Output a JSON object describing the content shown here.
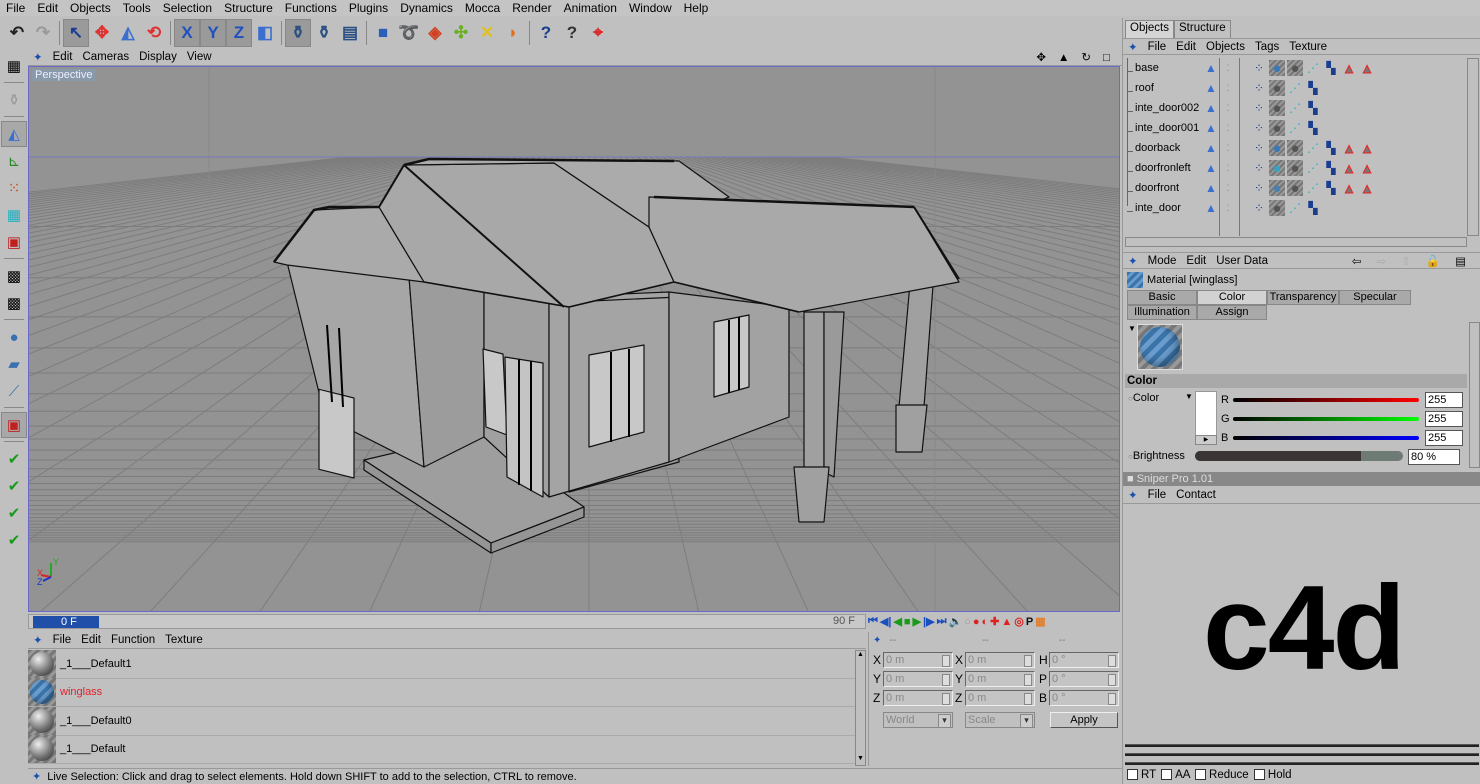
{
  "menubar": [
    "File",
    "Edit",
    "Objects",
    "Tools",
    "Selection",
    "Structure",
    "Functions",
    "Plugins",
    "Dynamics",
    "Mocca",
    "Render",
    "Animation",
    "Window",
    "Help"
  ],
  "toolbar": {
    "buttons": [
      {
        "name": "undo",
        "glyph": "↶"
      },
      {
        "name": "redo",
        "glyph": "↷"
      },
      {
        "name": "live-selection",
        "glyph": "↖",
        "selected": true
      },
      {
        "name": "move",
        "glyph": "✥"
      },
      {
        "name": "scale",
        "glyph": "◭"
      },
      {
        "name": "rotate",
        "glyph": "⟲"
      },
      {
        "name": "x-axis-lock",
        "glyph": "X"
      },
      {
        "name": "y-axis-lock",
        "glyph": "Y"
      },
      {
        "name": "z-axis-lock",
        "glyph": "Z"
      },
      {
        "name": "world-coords",
        "glyph": "⌐"
      },
      {
        "name": "render-view",
        "glyph": "⚱"
      },
      {
        "name": "render-picture-viewer",
        "glyph": "⚱"
      },
      {
        "name": "render-settings",
        "glyph": "▤"
      },
      {
        "name": "add-cube",
        "glyph": "■"
      },
      {
        "name": "add-spline",
        "glyph": "➰"
      },
      {
        "name": "add-nurbs",
        "glyph": "◈"
      },
      {
        "name": "add-array",
        "glyph": "✣"
      },
      {
        "name": "add-deformer",
        "glyph": "✕"
      },
      {
        "name": "add-scene",
        "glyph": "◗"
      },
      {
        "name": "help-pointer",
        "glyph": "?"
      },
      {
        "name": "help-window",
        "glyph": "?"
      },
      {
        "name": "target",
        "glyph": "⌖"
      }
    ]
  },
  "left_tools": [
    "viewport-layout",
    "render-active",
    "model-mode",
    "object-axis",
    "points-mode",
    "edges-mode",
    "polygons-mode",
    "texture-mode",
    "texture-axis-mode",
    "object-tool",
    "bone-tool",
    "ik-tool",
    "animation-mode",
    "ok-1",
    "ok-2",
    "ok-3",
    "ok-4"
  ],
  "viewport": {
    "menu": [
      "Edit",
      "Cameras",
      "Display",
      "View"
    ],
    "label": "Perspective",
    "axis": {
      "x": "X",
      "y": "Y",
      "z": "Z"
    }
  },
  "timeline": {
    "current": "0 F",
    "end": "90 F"
  },
  "material_manager": {
    "menu": [
      "File",
      "Edit",
      "Function",
      "Texture"
    ],
    "materials": [
      {
        "name": "_1___Default1",
        "type": "sphere",
        "selected": false
      },
      {
        "name": "winglass",
        "type": "glass",
        "selected": true
      },
      {
        "name": "_1___Default0",
        "type": "sphere",
        "selected": false
      },
      {
        "name": "_1___Default",
        "type": "sphere",
        "selected": false
      }
    ]
  },
  "coordinates": {
    "header": [
      "--",
      "--",
      "--"
    ],
    "position": [
      {
        "axis": "X",
        "value": "0 m"
      },
      {
        "axis": "Y",
        "value": "0 m"
      },
      {
        "axis": "Z",
        "value": "0 m"
      }
    ],
    "size": [
      {
        "axis": "X",
        "value": "0 m"
      },
      {
        "axis": "Y",
        "value": "0 m"
      },
      {
        "axis": "Z",
        "value": "0 m"
      }
    ],
    "rotation": [
      {
        "axis": "H",
        "value": "0 °"
      },
      {
        "axis": "P",
        "value": "0 °"
      },
      {
        "axis": "B",
        "value": "0 °"
      }
    ],
    "mode1": "World",
    "mode2": "Scale",
    "apply": "Apply"
  },
  "status": "Live Selection: Click and drag to select elements. Hold down SHIFT to add to the selection, CTRL to remove.",
  "object_manager": {
    "tabs": [
      "Objects",
      "Structure"
    ],
    "menu": [
      "File",
      "Edit",
      "Objects",
      "Tags",
      "Texture"
    ],
    "objects": [
      {
        "name": "base",
        "tags": [
          "phong",
          "mat-blue",
          "mat-grey",
          "uvw",
          "texture",
          "warn",
          "warn"
        ]
      },
      {
        "name": "roof",
        "tags": [
          "phong",
          "mat-grey",
          "uvw",
          "texture"
        ]
      },
      {
        "name": "inte_door002",
        "tags": [
          "phong",
          "mat-grey",
          "uvw",
          "texture"
        ]
      },
      {
        "name": "inte_door001",
        "tags": [
          "phong",
          "mat-grey",
          "uvw",
          "texture"
        ]
      },
      {
        "name": "doorback",
        "tags": [
          "phong",
          "mat-blue",
          "mat-grey",
          "uvw",
          "texture",
          "warn",
          "warn"
        ]
      },
      {
        "name": "doorfronleft",
        "tags": [
          "phong",
          "mat-cyan",
          "mat-grey",
          "uvw",
          "texture",
          "warn",
          "warn"
        ]
      },
      {
        "name": "doorfront",
        "tags": [
          "phong",
          "mat-glass",
          "mat-grey",
          "uvw",
          "texture",
          "warn",
          "warn"
        ]
      },
      {
        "name": "inte_door",
        "tags": [
          "phong",
          "mat-grey",
          "uvw",
          "texture"
        ]
      }
    ]
  },
  "attributes": {
    "menu": [
      "Mode",
      "Edit",
      "User Data"
    ],
    "title": "Material [winglass]",
    "tabs": [
      "Basic",
      "Color",
      "Transparency",
      "Specular",
      "Illumination",
      "Assign"
    ],
    "active_tab": "Color",
    "section": "Color",
    "color_label": "Color",
    "r_label": "R",
    "g_label": "G",
    "b_label": "B",
    "r": "255",
    "g": "255",
    "b": "255",
    "brightness_label": "Brightness",
    "brightness": "80 %",
    "brightness_fraction": 0.8
  },
  "sniper": {
    "title": "Sniper Pro 1.01",
    "menu": [
      "File",
      "Contact"
    ],
    "logo": "c4d",
    "options": [
      "RT",
      "AA",
      "Reduce",
      "Hold"
    ]
  }
}
